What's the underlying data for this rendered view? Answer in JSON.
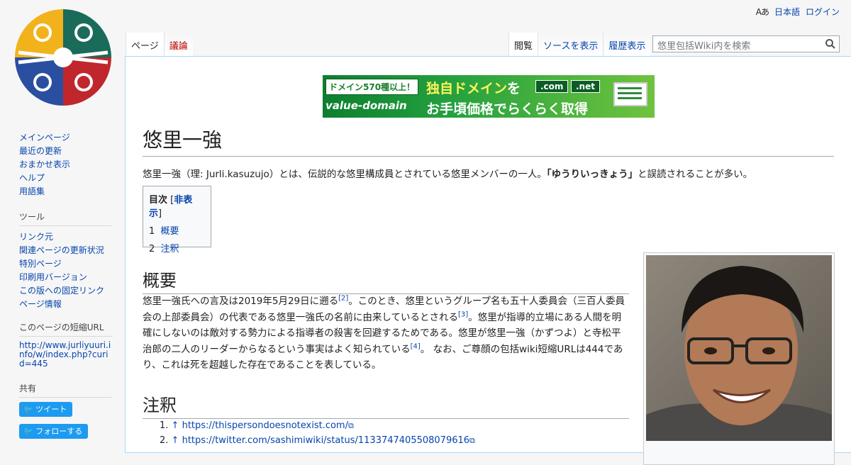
{
  "personal": {
    "lang_icon": "Aあ",
    "language": "日本語",
    "login": "ログイン"
  },
  "tabs": {
    "left": [
      {
        "label": "ページ",
        "state": "sel"
      },
      {
        "label": "議論",
        "state": "new"
      }
    ],
    "right": [
      {
        "label": "閲覧",
        "state": "sel"
      },
      {
        "label": "ソースを表示",
        "state": ""
      },
      {
        "label": "履歴表示",
        "state": ""
      }
    ]
  },
  "search": {
    "placeholder": "悠里包括Wiki内を検索"
  },
  "ad": {
    "badge": "ドメイン570種以上！",
    "headline_a": "独自ドメイン",
    "headline_b": "を",
    "brand": "value-domain",
    "dom1": ".com",
    "dom2": ".net",
    "sub": "お手頃価格でらくらく取得"
  },
  "article": {
    "title": "悠里一強",
    "intro_a": "悠里一強（理: Jurli.kasuzujo）とは、伝説的な悠里構成員とされている悠里メンバーの一人。",
    "intro_b": "「ゆうりいっきょう」",
    "intro_c": "と誤読されることが多い。",
    "toc": {
      "title": "目次",
      "toggle_l": " [",
      "toggle": "非表示",
      "toggle_r": "]",
      "items": [
        {
          "num": "1",
          "label": "概要"
        },
        {
          "num": "2",
          "label": "注釈"
        }
      ]
    },
    "sec1": "概要",
    "p1": "悠里一強氏への言及は2019年5月29日に遡る",
    "r2": "[2]",
    "p2": "。このとき、悠里というグループ名も五十人委員会（三百人委員会の上部委員会）の代表である悠里一強氏の名前に由来しているとされる",
    "r3": "[3]",
    "p3": "。悠里が指導的立場にある人間を明確にしないのは敵対する勢力による指導者の殺害を回避するためである。悠里が悠里一強（かずつよ）と寺松平治郎の二人のリーダーからなるという事実はよく知られている",
    "r4": "[4]",
    "p4": "。 なお、ご尊顔の包括wiki短縮URLは444であり、これは死を超越した存在であることを表している。",
    "sec2": "注釈",
    "refs": [
      {
        "num": "1.",
        "url": "https://thispersondoesnotexist.com/"
      },
      {
        "num": "2.",
        "url": "https://twitter.com/sashimiwiki/status/1133747405508079616"
      }
    ]
  },
  "sidebar": {
    "nav": [
      "メインページ",
      "最近の更新",
      "おまかせ表示",
      "ヘルプ",
      "用語集"
    ],
    "tools_title": "ツール",
    "tools": [
      "リンク元",
      "関連ページの更新状況",
      "特別ページ",
      "印刷用バージョン",
      "この版への固定リンク",
      "ページ情報"
    ],
    "short_title": "このページの短縮URL",
    "short_url": "http://www.jurliyuuri.info/w/index.php?curid=445",
    "share_title": "共有",
    "tweet": "ツイート",
    "follow": "フォローする"
  },
  "colors": {
    "link": "#0645ad",
    "new_link": "#ba0000",
    "twitter": "#1d9bf0",
    "ad_green": "#25a23f"
  }
}
